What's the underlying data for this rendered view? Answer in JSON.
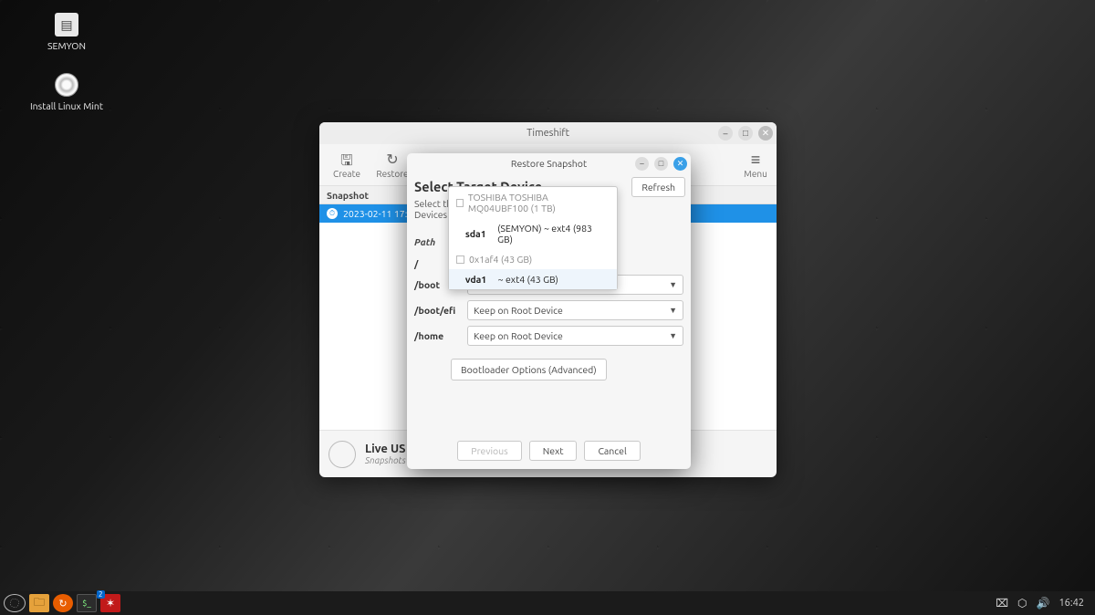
{
  "desktop": {
    "icon1_label": "SEMYON",
    "icon2_label": "Install Linux Mint"
  },
  "timeshift": {
    "title": "Timeshift",
    "toolbar": {
      "create": "Create",
      "restore": "Restore",
      "menu": "Menu"
    },
    "column_header": "Snapshot",
    "row1_time": "2023-02-11 17:26:",
    "footer_title": "Live US",
    "footer_sub": "Snapshots a"
  },
  "modal": {
    "title": "Restore Snapshot",
    "heading": "Select Target Device",
    "refresh": "Refresh",
    "line1": "Select the",
    "line2": "Devices fro",
    "path_header": "Path",
    "paths": {
      "root": "/",
      "boot": "/boot",
      "bootefi": "/boot/efi",
      "home": "/home"
    },
    "keep_label": "Keep on Root Device",
    "bootloader": "Bootloader Options (Advanced)",
    "prev": "Previous",
    "next": "Next",
    "cancel": "Cancel"
  },
  "dropdown": {
    "disk1": "TOSHIBA TOSHIBA MQ04UBF100 (1 TB)",
    "part1a": "sda1",
    "part1b": "(SEMYON) ~ ext4 (983 GB)",
    "disk2": "0x1af4 (43 GB)",
    "part2a": "vda1",
    "part2b": "~ ext4 (43 GB)"
  },
  "taskbar": {
    "term_badge": "2",
    "clock": "16:42"
  }
}
